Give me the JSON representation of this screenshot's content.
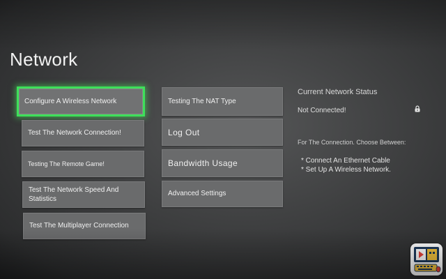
{
  "page": {
    "title": "Network"
  },
  "menu": {
    "left": [
      {
        "label": "Configure A Wireless Network",
        "selected": true
      },
      {
        "label": "Test The Network Connection!"
      },
      {
        "label": "Testing The Remote Game!"
      },
      {
        "label": "Test The Network Speed And Statistics"
      },
      {
        "label": "Test The Multiplayer Connection"
      }
    ],
    "right": [
      {
        "label": "Testing The NAT Type"
      },
      {
        "label": "Log Out"
      },
      {
        "label": "Bandwidth Usage"
      },
      {
        "label": "Advanced Settings"
      }
    ]
  },
  "status": {
    "heading": "Current Network Status",
    "value": "Not Connected!",
    "icon": "lock-icon",
    "choose_text": "For The Connection. Choose Between:",
    "options": [
      "Connect An Ethernet Cable",
      "Set Up A Wireless Network."
    ]
  },
  "colors": {
    "selection_glow": "#3ee05a",
    "tile": "#6a6b6c",
    "background": "#3f4041"
  },
  "watermark": {
    "icon": "computer-logo-icon"
  }
}
